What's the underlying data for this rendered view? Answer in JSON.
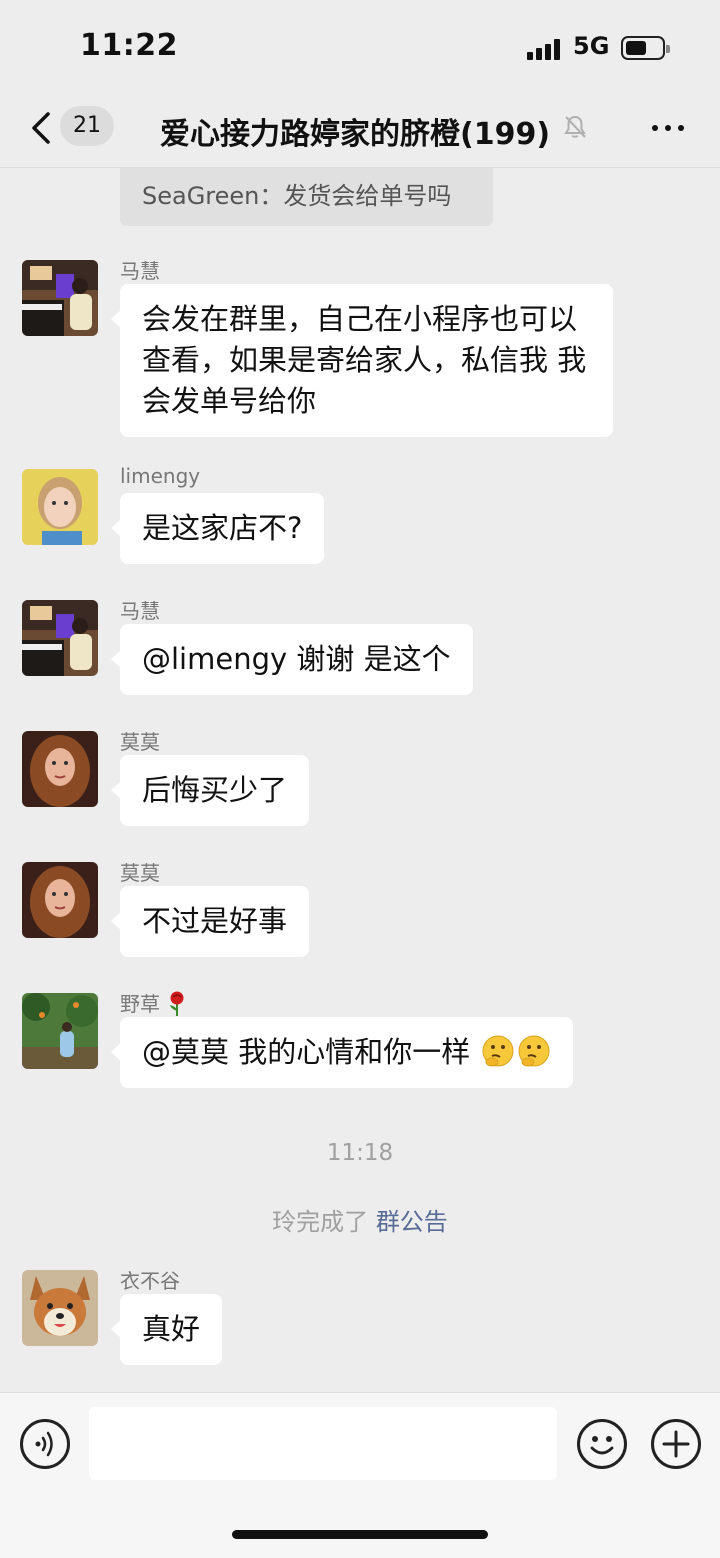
{
  "status_bar": {
    "time": "11:22",
    "network": "5G"
  },
  "nav": {
    "unread_count": "21",
    "title": "爱心接力路婷家的脐橙(199)",
    "mute_icon": "bell-mute-icon",
    "more_icon": "more-dots-icon"
  },
  "quoted_message": "SeaGreen：发货会给单号吗",
  "messages": [
    {
      "sender": "马慧",
      "text": "会发在群里，自己在小程序也可以查看，如果是寄给家人，私信我  我会发单号给你"
    },
    {
      "sender": "limengy",
      "text": "是这家店不?"
    },
    {
      "sender": "马慧",
      "text": "@limengy 谢谢  是这个"
    },
    {
      "sender": "莫莫",
      "text": "后悔买少了"
    },
    {
      "sender": "莫莫",
      "text": "不过是好事"
    },
    {
      "sender": "野草",
      "sender_emoji": "rose-emoji",
      "text": "@莫莫 我的心情和你一样",
      "emojis": [
        "thinking-face-emoji",
        "thinking-face-emoji"
      ]
    },
    {
      "sender": "衣不谷",
      "text": "真好"
    }
  ],
  "timestamp": "11:18",
  "system_message": {
    "prefix": "玲完成了 ",
    "link": "群公告"
  },
  "input_bar": {
    "voice_icon": "voice-icon",
    "placeholder": "",
    "emoji_icon": "emoji-icon",
    "plus_icon": "plus-icon"
  },
  "colors": {
    "background": "#ededed",
    "bubble": "#ffffff",
    "link": "#576b95",
    "meta_text": "#a0a0a0"
  }
}
